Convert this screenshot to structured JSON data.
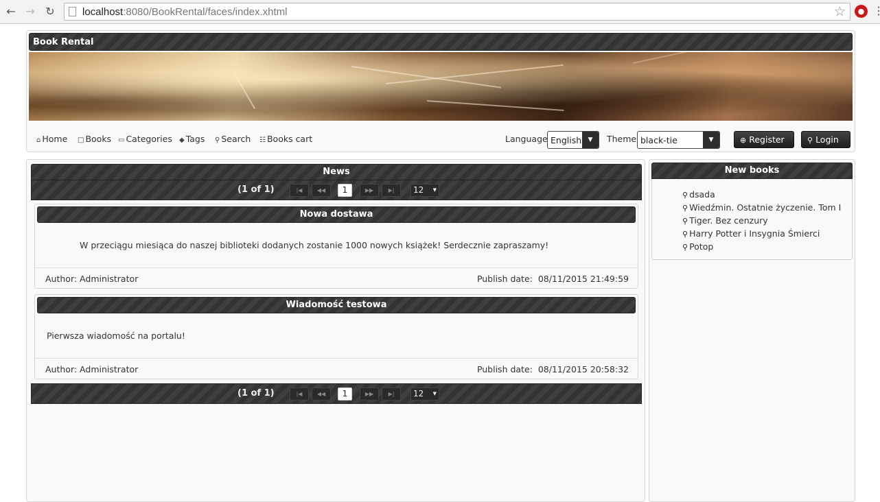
{
  "browser": {
    "url_host": "localhost",
    "url_rest": ":8080/BookRental/faces/index.xhtml"
  },
  "header": {
    "title": "Book Rental"
  },
  "menu": {
    "items": [
      {
        "label": "Home",
        "icon": "home-icon"
      },
      {
        "label": "Books",
        "icon": "document-icon"
      },
      {
        "label": "Categories",
        "icon": "link-icon"
      },
      {
        "label": "Tags",
        "icon": "tag-icon"
      },
      {
        "label": "Search",
        "icon": "search-icon"
      },
      {
        "label": "Books cart",
        "icon": "cart-icon"
      }
    ],
    "language_label": "Language",
    "language_value": "English",
    "theme_label": "Theme",
    "theme_value": "black-tie",
    "register_label": "Register",
    "login_label": "Login"
  },
  "news": {
    "title": "News",
    "page_report": "(1 of 1)",
    "current_page": "1",
    "rows_per_page": "12",
    "items": [
      {
        "title": "Nowa dostawa",
        "content": "W przeciągu miesiąca do naszej biblioteki dodanych zostanie 1000 nowych książek! Serdecznie zapraszamy!",
        "author": "Author: Administrator",
        "publish_label": "Publish date:",
        "publish_date": "08/11/2015 21:49:59"
      },
      {
        "title": "Wiadomość testowa",
        "content": "Pierwsza wiadomość na portalu!",
        "author": "Author: Administrator",
        "publish_label": "Publish date:",
        "publish_date": "08/11/2015 20:58:32"
      }
    ]
  },
  "new_books": {
    "title": "New books",
    "items": [
      "dsada",
      "Wiedźmin. Ostatnie życzenie. Tom I",
      "Tiger. Bez cenzury",
      "Harry Potter i Insygnia Śmierci",
      "Potop"
    ]
  }
}
